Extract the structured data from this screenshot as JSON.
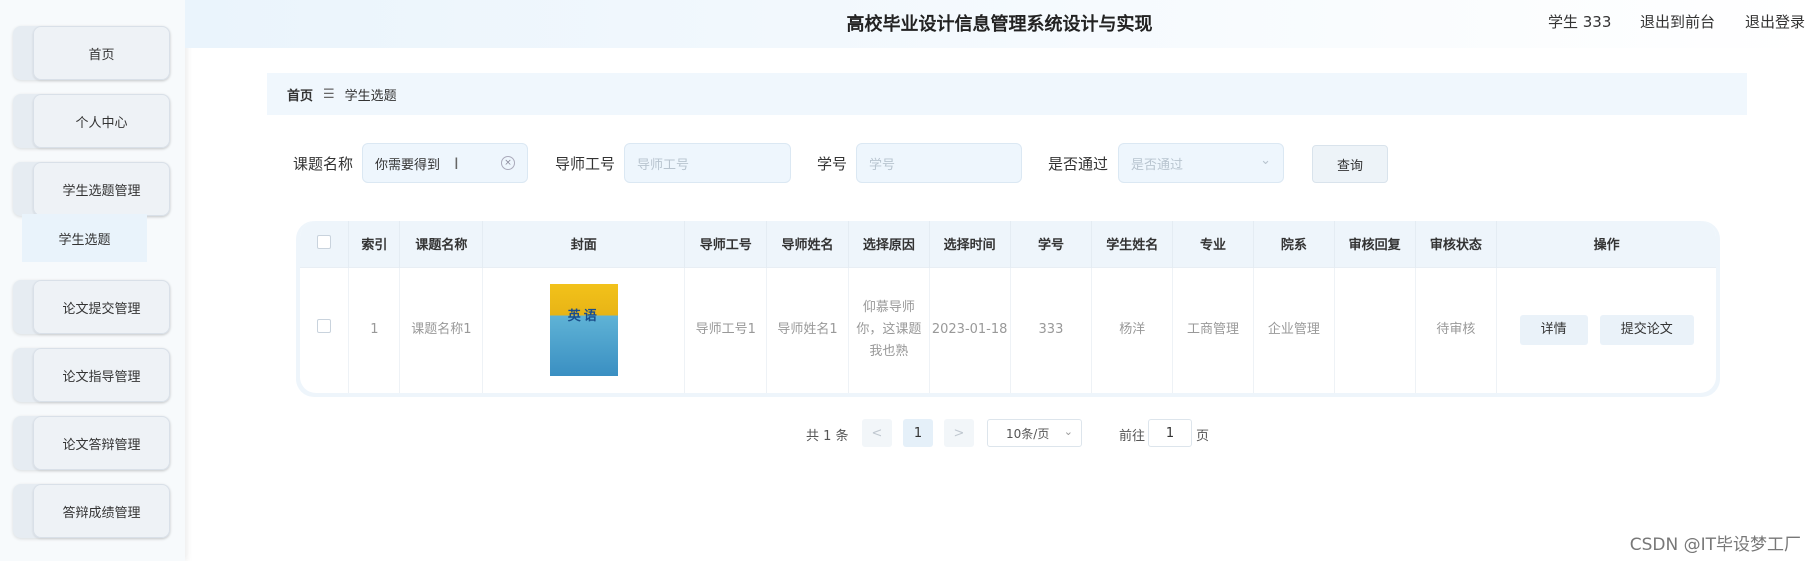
{
  "app": {
    "title": "高校毕业设计信息管理系统设计与实现"
  },
  "header": {
    "user": "学生 333",
    "back_front": "退出到前台",
    "logout": "退出登录"
  },
  "sidebar": {
    "items": [
      {
        "label": "首页"
      },
      {
        "label": "个人中心"
      },
      {
        "label": "学生选题管理"
      },
      {
        "label": "论文提交管理"
      },
      {
        "label": "论文指导管理"
      },
      {
        "label": "论文答辩管理"
      },
      {
        "label": "答辩成绩管理"
      }
    ],
    "submenu_active": "学生选题"
  },
  "breadcrumb": {
    "home": "首页",
    "separator": "☰",
    "current": "学生选题"
  },
  "search": {
    "topic_label": "课题名称",
    "topic_value": "你需要得到",
    "teacher_id_label": "导师工号",
    "teacher_id_placeholder": "导师工号",
    "student_id_label": "学号",
    "student_id_placeholder": "学号",
    "approved_label": "是否通过",
    "approved_placeholder": "是否通过",
    "query_button": "查询"
  },
  "table": {
    "headers": [
      "索引",
      "课题名称",
      "封面",
      "导师工号",
      "导师姓名",
      "选择原因",
      "选择时间",
      "学号",
      "学生姓名",
      "专业",
      "院系",
      "审核回复",
      "审核状态",
      "操作"
    ],
    "rows": [
      {
        "index": "1",
        "topic": "课题名称1",
        "cover_text": "英语",
        "teacher_id": "导师工号1",
        "teacher_name": "导师姓名1",
        "reason": "仰慕导师你，这课题我也熟",
        "time": "2023-01-18",
        "student_id": "333",
        "student_name": "杨洋",
        "major": "工商管理",
        "dept": "企业管理",
        "reply": "",
        "status": "待审核",
        "detail_btn": "详情",
        "submit_btn": "提交论文"
      }
    ]
  },
  "pagination": {
    "total": "共 1 条",
    "prev": "<",
    "current": "1",
    "next": ">",
    "page_size": "10条/页",
    "goto": "前往",
    "goto_value": "1",
    "page_unit": "页"
  },
  "watermark": "CSDN @IT毕设梦工厂"
}
